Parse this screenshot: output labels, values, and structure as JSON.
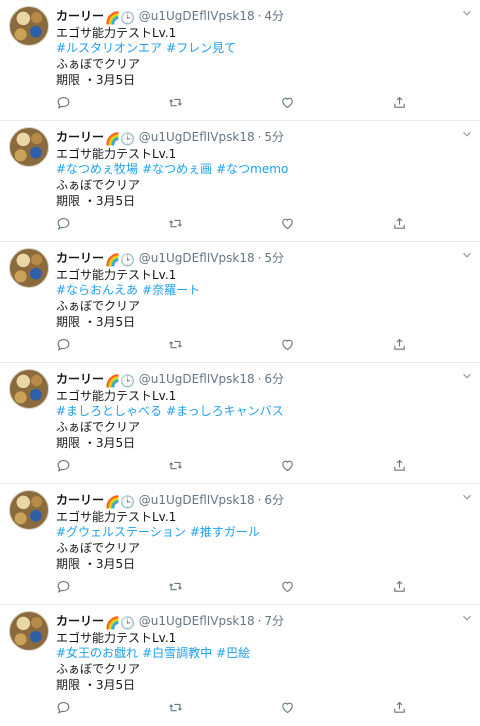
{
  "tweets": [
    {
      "name": "カーリー",
      "emoji": "🌈🕒",
      "handle": "@u1UgDEflIVpsk18",
      "time": "4分",
      "line1": "エゴサ能力テストLv.1",
      "tags": [
        "#ルスタリオンエア",
        "#フレン見て"
      ],
      "line3": "ふぁぼでクリア",
      "line4": "期限 ・3月5日"
    },
    {
      "name": "カーリー",
      "emoji": "🌈🕒",
      "handle": "@u1UgDEflIVpsk18",
      "time": "5分",
      "line1": "エゴサ能力テストLv.1",
      "tags": [
        "#なつめぇ牧場",
        "#なつめぇ画",
        "#なつmemo"
      ],
      "line3": "ふぁぼでクリア",
      "line4": "期限 ・3月5日"
    },
    {
      "name": "カーリー",
      "emoji": "🌈🕒",
      "handle": "@u1UgDEflIVpsk18",
      "time": "5分",
      "line1": "エゴサ能力テストLv.1",
      "tags": [
        "#ならおんえあ",
        "#奈羅ート"
      ],
      "line3": "ふぁぼでクリア",
      "line4": "期限 ・3月5日"
    },
    {
      "name": "カーリー",
      "emoji": "🌈🕒",
      "handle": "@u1UgDEflIVpsk18",
      "time": "6分",
      "line1": "エゴサ能力テストLv.1",
      "tags": [
        "#ましろとしゃべる",
        "#まっしろキャンバス"
      ],
      "line3": "ふぁぼでクリア",
      "line4": "期限 ・3月5日"
    },
    {
      "name": "カーリー",
      "emoji": "🌈🕒",
      "handle": "@u1UgDEflIVpsk18",
      "time": "6分",
      "line1": "エゴサ能力テストLv.1",
      "tags": [
        "#グウェルステーション",
        "#推すガール"
      ],
      "line3": "ふぁぼでクリア",
      "line4": "期限 ・3月5日"
    },
    {
      "name": "カーリー",
      "emoji": "🌈🕒",
      "handle": "@u1UgDEflIVpsk18",
      "time": "7分",
      "line1": "エゴサ能力テストLv.1",
      "tags": [
        "#女王のお戯れ",
        "#白雪調教中",
        "#巴絵"
      ],
      "line3": "ふぁぼでクリア",
      "line4": "期限 ・3月5日"
    }
  ],
  "icons": {
    "reply": "reply-icon",
    "retweet": "retweet-icon",
    "like": "like-icon",
    "share": "share-icon",
    "caret": "chevron-down-icon"
  },
  "colors": {
    "hashtag": "#1da1f2",
    "muted": "#657786",
    "icon": "#657786",
    "divider": "#e6ecf0"
  }
}
